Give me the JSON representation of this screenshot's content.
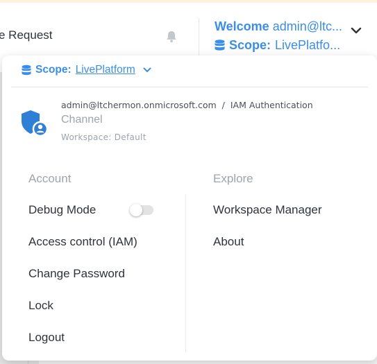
{
  "header": {
    "title_partial": "e Request",
    "welcome_label": "Welcome",
    "welcome_user": "admin@ltc...",
    "scope_label": "Scope:",
    "scope_value": "LivePlatfo..."
  },
  "dropdown": {
    "scope_label": "Scope:",
    "scope_value": "LivePlatform",
    "identity": {
      "email": "admin@ltchermon.onmicrosoft.com",
      "separator": "/",
      "auth": "IAM Authentication",
      "channel": "Channel",
      "workspace": "Workspace: Default"
    },
    "account": {
      "title": "Account",
      "items": [
        "Debug Mode",
        "Access control (IAM)",
        "Change Password",
        "Lock",
        "Logout"
      ]
    },
    "explore": {
      "title": "Explore",
      "items": [
        "Workspace Manager",
        "About"
      ]
    },
    "debug_mode_enabled": false
  },
  "icons": {
    "bell": "bell-icon",
    "database": "database-icon",
    "chevron": "chevron-down-icon",
    "shield_user": "shield-user-icon"
  },
  "colors": {
    "accent": "#3a8ee6",
    "muted": "#9ea4ac",
    "text": "#2f3338"
  }
}
